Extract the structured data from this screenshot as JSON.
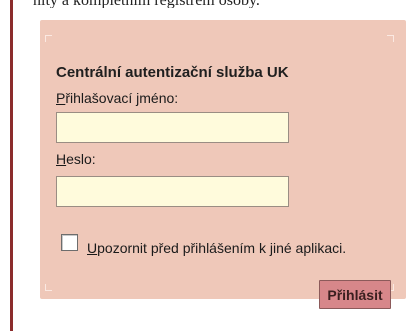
{
  "header_fragment": "nity a kompletním registrem osoby.",
  "form": {
    "title": "Centrální autentizační služba UK",
    "username": {
      "label_accesskey": "P",
      "label_rest": "řihlašovací jméno:",
      "value": ""
    },
    "password": {
      "label_accesskey": "H",
      "label_rest": "eslo:",
      "value": ""
    },
    "warn": {
      "checked": false,
      "label_accesskey": "U",
      "label_rest": "pozornit před přihlášením k jiné aplikaci."
    },
    "submit_label": "Přihlásit"
  },
  "colors": {
    "panel_background": "#efc8b9",
    "input_background": "#fffbdc",
    "button_background": "#d7878a",
    "left_rule": "#8b2c2c"
  }
}
